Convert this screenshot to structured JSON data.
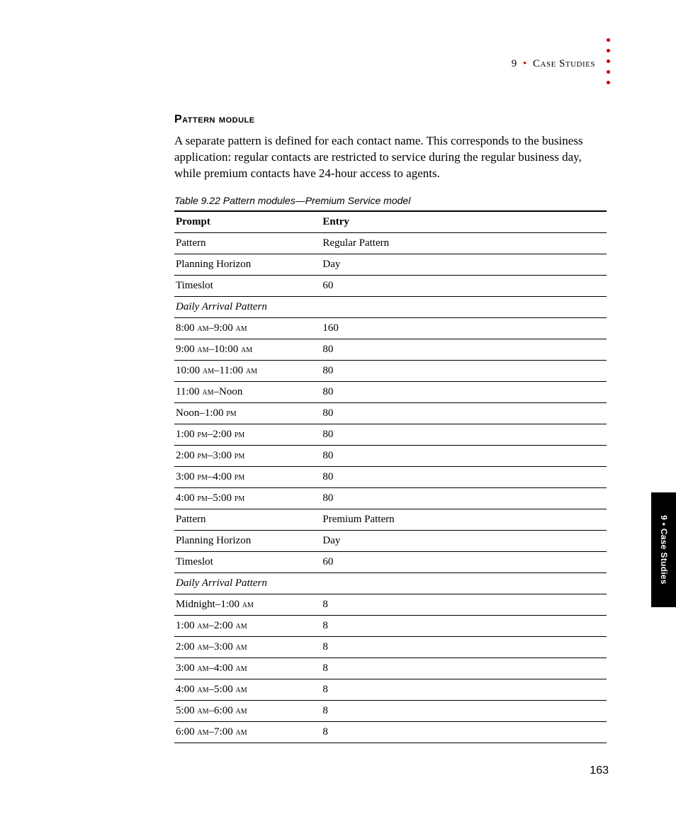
{
  "header": {
    "chapter_number": "9",
    "bullet": "•",
    "chapter_title": "Case Studies"
  },
  "section": {
    "title": "Pattern module",
    "paragraph": "A separate pattern is defined for each contact name. This corresponds to the business application: regular contacts are restricted to service during the regular business day, while premium contacts have 24-hour access to agents."
  },
  "table": {
    "caption": "Table 9.22 Pattern modules—Premium Service model",
    "head": {
      "prompt": "Prompt",
      "entry": "Entry"
    },
    "rows": [
      {
        "prompt": "Pattern",
        "entry": "Regular Pattern"
      },
      {
        "prompt": "Planning Horizon",
        "entry": "Day"
      },
      {
        "prompt": "Timeslot",
        "entry": "60"
      },
      {
        "prompt": "Daily Arrival Pattern",
        "entry": "",
        "section": true
      },
      {
        "prompt_html": "8:00 <span class=\"sc\">am</span>–9:00 <span class=\"sc\">am</span>",
        "entry": "160"
      },
      {
        "prompt_html": "9:00 <span class=\"sc\">am</span>–10:00 <span class=\"sc\">am</span>",
        "entry": "80"
      },
      {
        "prompt_html": "10:00 <span class=\"sc\">am</span>–11:00 <span class=\"sc\">am</span>",
        "entry": "80"
      },
      {
        "prompt_html": "11:00 <span class=\"sc\">am</span>–Noon",
        "entry": "80"
      },
      {
        "prompt_html": "Noon–1:00 <span class=\"sc\">pm</span>",
        "entry": "80"
      },
      {
        "prompt_html": "1:00 <span class=\"sc\">pm</span>–2:00 <span class=\"sc\">pm</span>",
        "entry": "80"
      },
      {
        "prompt_html": "2:00 <span class=\"sc\">pm</span>–3:00 <span class=\"sc\">pm</span>",
        "entry": "80"
      },
      {
        "prompt_html": "3:00 <span class=\"sc\">pm</span>–4:00 <span class=\"sc\">pm</span>",
        "entry": "80"
      },
      {
        "prompt_html": "4:00 <span class=\"sc\">pm</span>–5:00 <span class=\"sc\">pm</span>",
        "entry": "80"
      },
      {
        "prompt": "Pattern",
        "entry": "Premium Pattern"
      },
      {
        "prompt": "Planning Horizon",
        "entry": "Day"
      },
      {
        "prompt": "Timeslot",
        "entry": "60"
      },
      {
        "prompt": "Daily Arrival Pattern",
        "entry": "",
        "section": true
      },
      {
        "prompt_html": "Midnight–1:00 <span class=\"sc\">am</span>",
        "entry": "8"
      },
      {
        "prompt_html": "1:00 <span class=\"sc\">am</span>–2:00 <span class=\"sc\">am</span>",
        "entry": "8"
      },
      {
        "prompt_html": "2:00 <span class=\"sc\">am</span>–3:00 <span class=\"sc\">am</span>",
        "entry": "8"
      },
      {
        "prompt_html": "3:00 <span class=\"sc\">am</span>–4:00 <span class=\"sc\">am</span>",
        "entry": "8"
      },
      {
        "prompt_html": "4:00 <span class=\"sc\">am</span>–5:00 <span class=\"sc\">am</span>",
        "entry": "8"
      },
      {
        "prompt_html": "5:00 <span class=\"sc\">am</span>–6:00 <span class=\"sc\">am</span>",
        "entry": "8"
      },
      {
        "prompt_html": "6:00 <span class=\"sc\">am</span>–7:00 <span class=\"sc\">am</span>",
        "entry": "8"
      }
    ]
  },
  "side_tab": {
    "text": "9 • Case Studies"
  },
  "page_number": "163"
}
